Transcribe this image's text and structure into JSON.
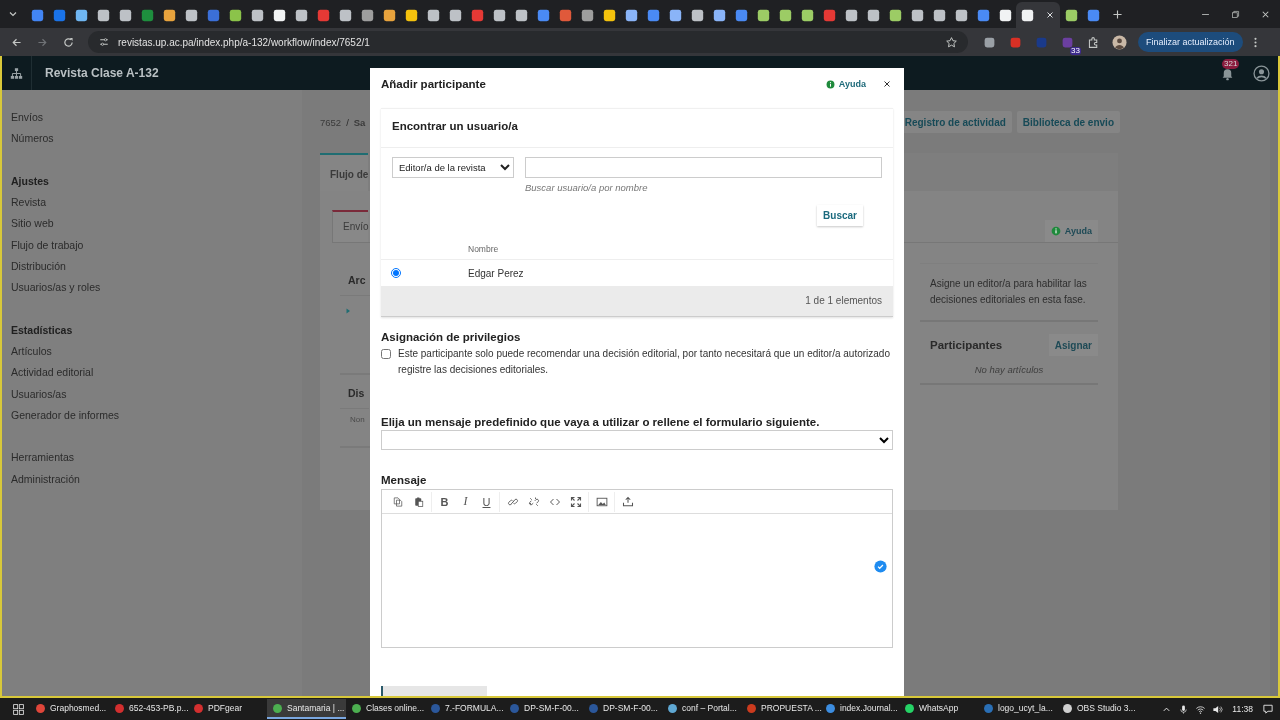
{
  "browser": {
    "tabs": [
      {
        "color": "#4285f4",
        "selected": false
      },
      {
        "color": "#1a73e8",
        "selected": false
      },
      {
        "color": "#6fb6f2",
        "selected": false
      },
      {
        "color": "#bdc1c6",
        "selected": false
      },
      {
        "color": "#bdc1c6",
        "selected": false
      },
      {
        "color": "#1e8e3e",
        "selected": false
      },
      {
        "color": "#e8a33d",
        "selected": false
      },
      {
        "color": "#bdc1c6",
        "selected": false
      },
      {
        "color": "#3b6fd8",
        "selected": false
      },
      {
        "color": "#8bc34a",
        "selected": false
      },
      {
        "color": "#bdc1c6",
        "selected": false
      },
      {
        "color": "#f1f3f4",
        "selected": false
      },
      {
        "color": "#bdc1c6",
        "selected": false
      },
      {
        "color": "#e53935",
        "selected": false
      },
      {
        "color": "#bdc1c6",
        "selected": false
      },
      {
        "color": "#9e9e9e",
        "selected": false
      },
      {
        "color": "#e8a33d",
        "selected": false
      },
      {
        "color": "#f4c20d",
        "selected": false
      },
      {
        "color": "#bdc1c6",
        "selected": false
      },
      {
        "color": "#bdc1c6",
        "selected": false
      },
      {
        "color": "#e53935",
        "selected": false
      },
      {
        "color": "#bdc1c6",
        "selected": false
      },
      {
        "color": "#bdc1c6",
        "selected": false
      },
      {
        "color": "#4a8af4",
        "selected": false
      },
      {
        "color": "#e0593b",
        "selected": false
      },
      {
        "color": "#9e9e9e",
        "selected": false
      },
      {
        "color": "#f4c20d",
        "selected": false
      },
      {
        "color": "#8ab4f8",
        "selected": false
      },
      {
        "color": "#4a8af4",
        "selected": false
      },
      {
        "color": "#8ab4f8",
        "selected": false
      },
      {
        "color": "#bdc1c6",
        "selected": false
      },
      {
        "color": "#8ab4f8",
        "selected": false
      },
      {
        "color": "#4a8af4",
        "selected": false
      },
      {
        "color": "#9ccc65",
        "selected": false
      },
      {
        "color": "#9ccc65",
        "selected": false
      },
      {
        "color": "#9ccc65",
        "selected": false
      },
      {
        "color": "#e53935",
        "selected": false
      },
      {
        "color": "#bdc1c6",
        "selected": false
      },
      {
        "color": "#bdc1c6",
        "selected": false
      },
      {
        "color": "#9ccc65",
        "selected": false
      },
      {
        "color": "#bdc1c6",
        "selected": false
      },
      {
        "color": "#bdc1c6",
        "selected": false
      },
      {
        "color": "#bdc1c6",
        "selected": false
      },
      {
        "color": "#4a8af4",
        "selected": false
      },
      {
        "color": "#f1f3f4",
        "selected": false
      },
      {
        "color": "#f1f3f4",
        "selected": true
      },
      {
        "color": "#9ccc65",
        "selected": false
      },
      {
        "color": "#4a8af4",
        "selected": false
      }
    ],
    "url": "revistas.up.ac.pa/index.php/a-132/workflow/index/7652/1",
    "extensions": [
      {
        "color": "#9aa0a6"
      },
      {
        "color": "#d93025"
      },
      {
        "color": "#1a3a8a"
      },
      {
        "color": "#6b3fa0",
        "badge": "33"
      }
    ],
    "update_button": "Finalizar actualización"
  },
  "app": {
    "title": "Revista Clase A-132",
    "notification_count": "321"
  },
  "sidebar": {
    "groups": [
      {
        "items": [
          "Envíos",
          "Números"
        ]
      },
      {
        "heading": "Ajustes",
        "items": [
          "Revista",
          "Sitio web",
          "Flujo de trabajo",
          "Distribución",
          "Usuarios/as y roles"
        ]
      },
      {
        "heading": "Estadísticas",
        "items": [
          "Artículos",
          "Actividad editorial",
          "Usuarios/as",
          "Generador de informes"
        ]
      },
      {
        "items": [
          "Herramientas",
          "Administración"
        ]
      }
    ]
  },
  "workflow": {
    "breadcrumb_id": "7652",
    "breadcrumb_separator": "/",
    "breadcrumb_title": "Sa",
    "actions": [
      "Registro de actividad",
      "Biblioteca de envio"
    ],
    "stage_tab": "Flujo de",
    "sub_tab": "Envío",
    "help": "Ayuda",
    "files_title": "Arc",
    "discussions_title": "Dis",
    "discussions_column": "Non",
    "notice": "Asigne un editor/a para habilitar las decisiones editoriales en esta fase.",
    "participants_title": "Participantes",
    "assign_button": "Asignar",
    "participants_empty": "No hay artículos"
  },
  "modal": {
    "title": "Añadir participante",
    "help": "Ayuda",
    "find_title": "Encontrar un usuario/a",
    "role_select": "Editor/a de la revista",
    "search_help": "Buscar usuario/a por nombre",
    "search_button": "Buscar",
    "table": {
      "columns": [
        "Nombre"
      ],
      "rows": [
        {
          "name": "Edgar Perez",
          "selected": true
        }
      ],
      "footer": "1 de 1 elementos"
    },
    "privileges_title": "Asignación de privilegios",
    "privileges_checkbox": {
      "label": "Este participante solo puede recomendar una decisión editorial, por tanto necesitará que un editor/a autorizado registre las decisiones editoriales.",
      "checked": false
    },
    "template_label": "Elija un mensaje predefinido que vaya a utilizar o rellene el formulario siguiente.",
    "message_label": "Mensaje",
    "toolbar_groups": [
      {
        "tools": [
          {
            "kind": "copy"
          },
          {
            "kind": "paste"
          }
        ]
      },
      {
        "tools": [
          {
            "kind": "bold",
            "label": "B"
          },
          {
            "kind": "italic",
            "label": "I"
          },
          {
            "kind": "underline",
            "label": "U"
          }
        ]
      },
      {
        "tools": [
          {
            "kind": "link"
          },
          {
            "kind": "unlink"
          },
          {
            "kind": "code"
          },
          {
            "kind": "fullscreen"
          }
        ]
      },
      {
        "tools": [
          {
            "kind": "image"
          }
        ]
      },
      {
        "tools": [
          {
            "kind": "upload"
          }
        ]
      }
    ]
  },
  "taskbar": {
    "items": [
      {
        "label": "Graphosmed...",
        "color": "#e0463a",
        "selected": false
      },
      {
        "label": "652-453-PB.p...",
        "color": "#d32f2f",
        "selected": false
      },
      {
        "label": "PDFgear",
        "color": "#d32f2f",
        "selected": false
      },
      {
        "label": "Santamaria | ...",
        "color": "#4caf50",
        "selected": true
      },
      {
        "label": "Clases online...",
        "color": "#4caf50",
        "selected": false
      },
      {
        "label": "7.-FORMULA...",
        "color": "#2b579a",
        "selected": false
      },
      {
        "label": "DP-SM-F-00...",
        "color": "#2b579a",
        "selected": false
      },
      {
        "label": "DP-SM-F-00...",
        "color": "#2b579a",
        "selected": false
      },
      {
        "label": "conf – Portal...",
        "color": "#5fa8d3",
        "selected": false
      },
      {
        "label": "PROPUESTA ...",
        "color": "#cc3b1e",
        "selected": false
      },
      {
        "label": "index.Journal...",
        "color": "#3c8de0",
        "selected": false
      },
      {
        "label": "WhatsApp",
        "color": "#25d366",
        "selected": false
      },
      {
        "label": "logo_ucyt_la...",
        "color": "#2a6fb5",
        "selected": false
      },
      {
        "label": "OBS Studio 3...",
        "color": "#cfcfcf",
        "selected": false
      }
    ],
    "time": "11:38"
  }
}
